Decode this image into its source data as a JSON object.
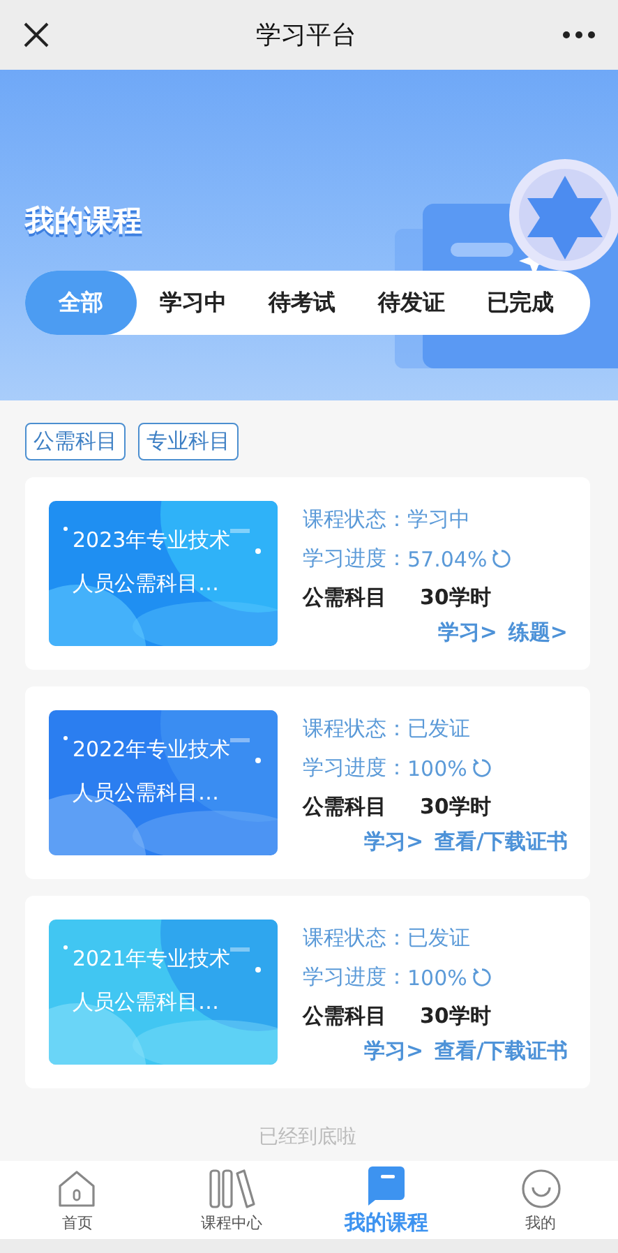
{
  "window": {
    "title": "学习平台"
  },
  "banner": {
    "title": "我的课程"
  },
  "tabs": [
    {
      "label": "全部",
      "selected": true
    },
    {
      "label": "学习中",
      "selected": false
    },
    {
      "label": "待考试",
      "selected": false
    },
    {
      "label": "待发证",
      "selected": false
    },
    {
      "label": "已完成",
      "selected": false
    }
  ],
  "filters": [
    "公需科目",
    "专业科目"
  ],
  "courses": [
    {
      "title": "2023年专业技术人员公需科目…",
      "status_label": "课程状态：",
      "status": "学习中",
      "progress_label": "学习进度：",
      "progress": "57.04%",
      "category": "公需科目",
      "hours": "30学时",
      "actions": [
        "学习>",
        "练题>"
      ]
    },
    {
      "title": "2022年专业技术人员公需科目…",
      "status_label": "课程状态：",
      "status": "已发证",
      "progress_label": "学习进度：",
      "progress": "100%",
      "category": "公需科目",
      "hours": "30学时",
      "actions": [
        "学习>",
        "查看/下载证书"
      ]
    },
    {
      "title": "2021年专业技术人员公需科目…",
      "status_label": "课程状态：",
      "status": "已发证",
      "progress_label": "学习进度：",
      "progress": "100%",
      "category": "公需科目",
      "hours": "30学时",
      "actions": [
        "学习>",
        "查看/下载证书"
      ]
    }
  ],
  "end_note": "已经到底啦",
  "bottom_nav": [
    {
      "label": "首页",
      "kind": "home",
      "selected": false
    },
    {
      "label": "课程中心",
      "kind": "books",
      "selected": false
    },
    {
      "label": "我的课程",
      "kind": "chat",
      "selected": true
    },
    {
      "label": "我的",
      "kind": "smile",
      "selected": false
    }
  ]
}
